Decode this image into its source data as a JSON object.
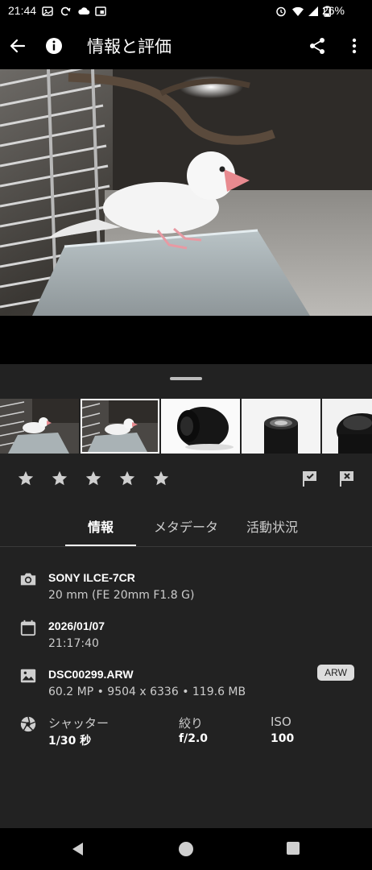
{
  "status_bar": {
    "time": "21:44",
    "battery": "26%"
  },
  "app_bar": {
    "title": "情報と評価"
  },
  "rating": {
    "stars": 0,
    "max_stars": 5
  },
  "tabs": [
    {
      "label": "情報",
      "active": true
    },
    {
      "label": "メタデータ",
      "active": false
    },
    {
      "label": "活動状況",
      "active": false
    }
  ],
  "info": {
    "camera": {
      "model": "SONY ILCE-7CR",
      "lens": "20 mm (FE 20mm F1.8 G)"
    },
    "date": {
      "date": "2026/01/07",
      "time": "21:17:40"
    },
    "file": {
      "name": "DSC00299.ARW",
      "details": "60.2 MP • 9504 x 6336 • 119.6 MB",
      "badge": "ARW"
    },
    "exposure": {
      "shutter_label": "シャッター",
      "shutter_value": "1/30 秒",
      "aperture_label": "絞り",
      "aperture_value": "f/2.0",
      "iso_label": "ISO",
      "iso_value": "100"
    }
  }
}
